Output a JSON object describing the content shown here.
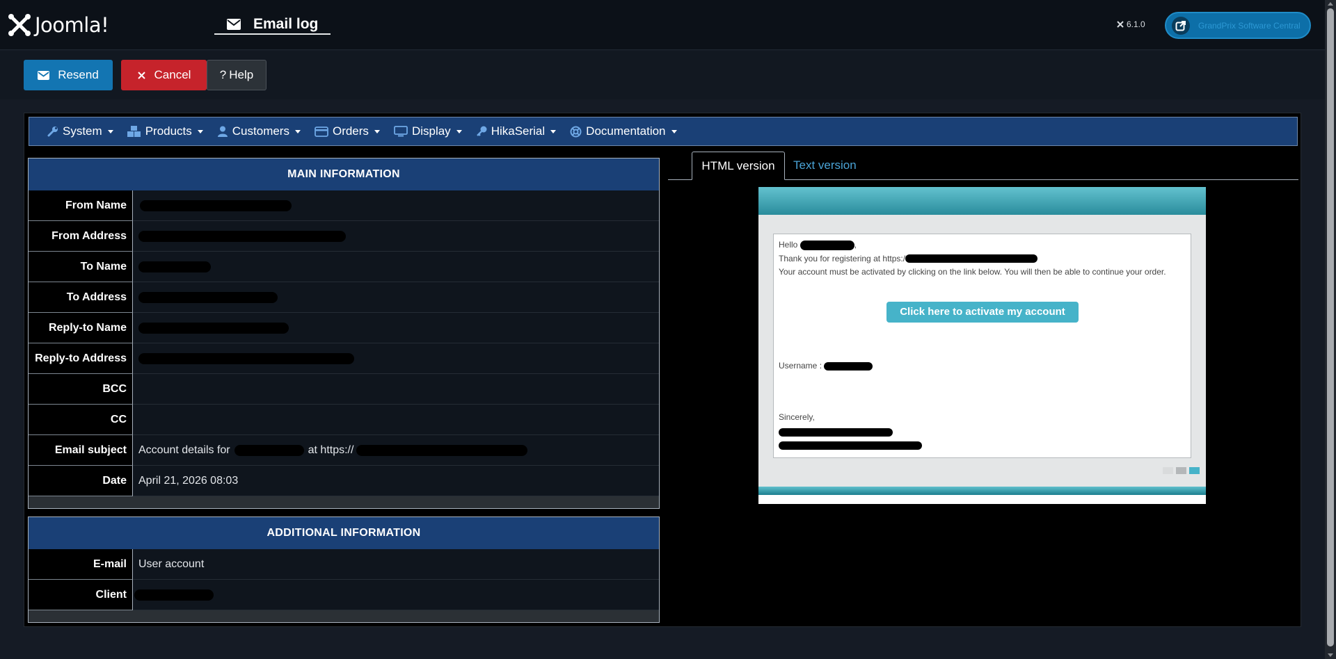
{
  "header": {
    "brand": "Joomla!",
    "page_title": "Email log",
    "version": "6.1.0",
    "site_button": "GrandPrix Software Central"
  },
  "toolbar": {
    "resend_label": "Resend",
    "cancel_label": "Cancel",
    "help_label": "Help"
  },
  "menubar": {
    "items": [
      "System",
      "Products",
      "Customers",
      "Orders",
      "Display",
      "HikaSerial",
      "Documentation"
    ]
  },
  "main_info": {
    "heading": "MAIN INFORMATION",
    "labels": {
      "from_name": "From Name",
      "from_address": "From Address",
      "to_name": "To Name",
      "to_address": "To Address",
      "reply_to_name": "Reply-to Name",
      "reply_to_address": "Reply-to Address",
      "bcc": "BCC",
      "cc": "CC",
      "email_subject": "Email subject",
      "date": "Date"
    },
    "values": {
      "subject_prefix": "Account details for",
      "subject_mid": "at https://",
      "date": "April 21, 2026 08:03"
    }
  },
  "additional_info": {
    "heading": "ADDITIONAL INFORMATION",
    "labels": {
      "email": "E-mail",
      "client": "Client"
    },
    "values": {
      "email": "User account"
    }
  },
  "tabs": {
    "html": "HTML version",
    "text": "Text version"
  },
  "email_preview": {
    "hello": "Hello",
    "thanks": "Thank you for registering at https:/",
    "activation_note": "Your account must be activated by clicking on the link below. You will then be able to continue your order.",
    "cta": "Click here to activate my account",
    "username_label": "Username :",
    "closing": "Sincerely,"
  },
  "colors": {
    "primary": "#1375b2",
    "danger": "#c6232b",
    "menubar": "#1a4076",
    "accent_teal": "#46b3c9"
  }
}
